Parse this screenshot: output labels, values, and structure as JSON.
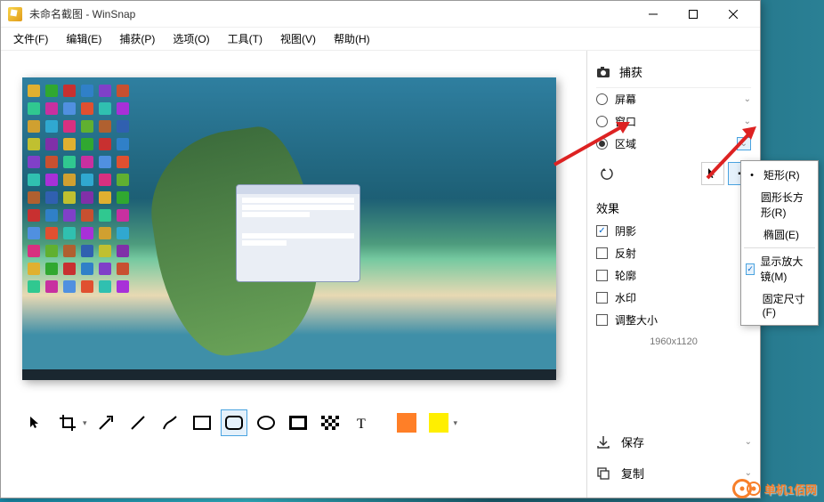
{
  "title": "未命名截图 - WinSnap",
  "menubar": [
    "文件(F)",
    "编辑(E)",
    "捕获(P)",
    "选项(O)",
    "工具(T)",
    "视图(V)",
    "帮助(H)"
  ],
  "capture": {
    "header": "捕获",
    "options": [
      {
        "name": "screen",
        "label": "屏幕",
        "checked": false,
        "expand": true
      },
      {
        "name": "window",
        "label": "窗口",
        "checked": false,
        "expand": true
      },
      {
        "name": "region",
        "label": "区域",
        "checked": true,
        "expand": true,
        "selected": true
      }
    ]
  },
  "effects": {
    "header": "效果",
    "items": [
      {
        "name": "shadow",
        "label": "阴影",
        "checked": true,
        "expand": true
      },
      {
        "name": "reflect",
        "label": "反射",
        "checked": false,
        "expand": false
      },
      {
        "name": "outline",
        "label": "轮廓",
        "checked": false,
        "expand": true
      },
      {
        "name": "watermark",
        "label": "水印",
        "checked": false,
        "expand": true
      },
      {
        "name": "resize",
        "label": "调整大小",
        "checked": false,
        "expand": true
      }
    ]
  },
  "dimensions": "1960x1120",
  "bottom": {
    "save": "保存",
    "copy": "复制"
  },
  "region_menu": [
    {
      "label": "矩形(R)",
      "bullet": true
    },
    {
      "label": "圆形长方形(R)"
    },
    {
      "label": "椭圆(E)"
    },
    {
      "label": "显示放大镜(M)",
      "check": true
    },
    {
      "label": "固定尺寸(F)"
    }
  ],
  "watermark_text": "单机1佰网",
  "icon_colors": [
    "#e0b030",
    "#30a830",
    "#c83030",
    "#3080c8",
    "#8040c8",
    "#c85030",
    "#30c890",
    "#c830a0",
    "#5090e0",
    "#e05030",
    "#30c0b0",
    "#a830d8",
    "#d0a030",
    "#30a8d0",
    "#d83080",
    "#60b030",
    "#b06030",
    "#3060b0",
    "#c0c030",
    "#8030a8"
  ]
}
